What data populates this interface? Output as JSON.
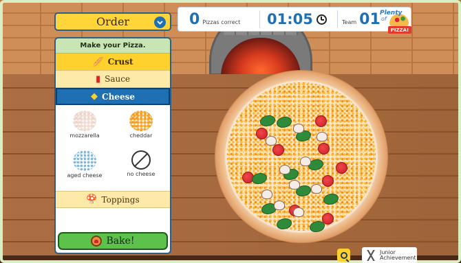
{
  "header": {
    "order_label": "Order",
    "score_value": "0",
    "score_label": "Pizzas correct",
    "timer": "01:05",
    "team_label": "Team",
    "team_value": "01",
    "logo_line1": "Plenty",
    "logo_line2": "of",
    "logo_banner": "PIZZA!"
  },
  "panel": {
    "title": "Make your Pizza.",
    "categories": [
      {
        "label": "Crust",
        "icon": "crust-icon"
      },
      {
        "label": "Sauce",
        "icon": "sauce-icon"
      },
      {
        "label": "Cheese",
        "icon": "cheese-icon",
        "selected": true
      },
      {
        "label": "Toppings",
        "icon": "toppings-icon"
      }
    ],
    "cheese_options": [
      {
        "label": "mozzarella"
      },
      {
        "label": "cheddar"
      },
      {
        "label": "aged cheese"
      },
      {
        "label": "no cheese"
      }
    ]
  },
  "actions": {
    "bake_label": "Bake!"
  },
  "footer": {
    "brand_line1": "Junior",
    "brand_line2": "Achievement"
  }
}
